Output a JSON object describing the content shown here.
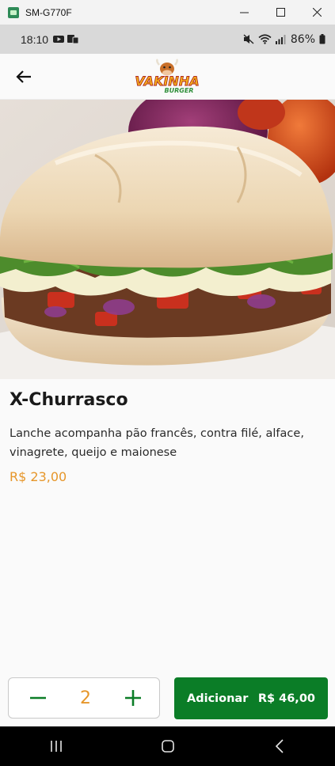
{
  "window": {
    "title": "SM-G770F"
  },
  "status_bar": {
    "time": "18:10",
    "battery": "86%"
  },
  "product": {
    "name": "X-Churrasco",
    "description": "Lanche acompanha pão francês, contra filé, alface, vinagrete, queijo e maionese",
    "price": "R$ 23,00"
  },
  "logo": {
    "word1": "VAKINHA",
    "word2": "BURGER"
  },
  "cart": {
    "quantity": "2",
    "add_label": "Adicionar",
    "total": "R$ 46,00"
  },
  "colors": {
    "accent": "#e6962a",
    "primary": "#0b7d27"
  }
}
